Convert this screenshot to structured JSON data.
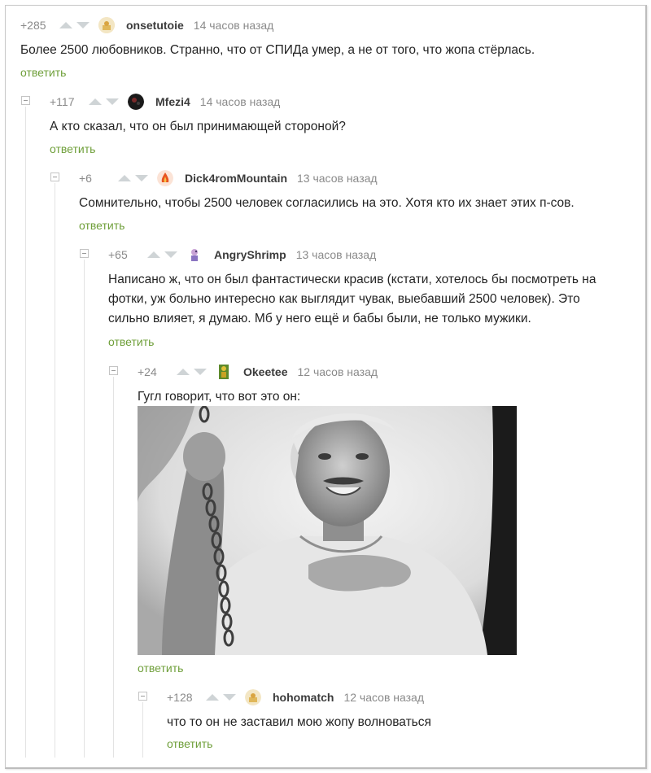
{
  "comments": [
    {
      "rating": "+285",
      "username": "onsetutoie",
      "time": "14 часов назад",
      "text": "Более 2500 любовников. Странно, что от СПИДа умер, а не от того, что жопа стёрлась.",
      "reply": "ответить"
    },
    {
      "rating": "+117",
      "username": "Mfezi4",
      "time": "14 часов назад",
      "text": "А кто сказал, что он был принимающей стороной?",
      "reply": "ответить"
    },
    {
      "rating": "+6",
      "username": "Dick4romMountain",
      "time": "13 часов назад",
      "text": "Сомнительно, чтобы 2500 человек согласились на это. Хотя кто их знает этих п-сов.",
      "reply": "ответить"
    },
    {
      "rating": "+65",
      "username": "AngryShrimp",
      "time": "13 часов назад",
      "text_lines": [
        "Написано ж, что он был фантастически красив (кстати, хотелось бы посмотреть на",
        "фотки, уж больно интересно как выглядит чувак, выебавший 2500 человек). Это",
        "сильно влияет, я думаю. Мб у него ещё и бабы были, не только мужики."
      ],
      "reply": "ответить"
    },
    {
      "rating": "+24",
      "username": "Okeetee",
      "time": "12 часов назад",
      "text": "Гугл говорит, что вот это он:",
      "reply": "ответить"
    },
    {
      "rating": "+128",
      "username": "hohomatch",
      "time": "12 часов назад",
      "text": "что то он не заставил мою жопу волноваться",
      "reply": "ответить"
    }
  ],
  "colors": {
    "reply_link": "#6f9f3a",
    "meta_gray": "#8a8a8a",
    "vote_arrow": "#cfd4d6"
  },
  "icons": {
    "upvote": "arrow-up-icon",
    "downvote": "arrow-down-icon",
    "collapse": "collapse-minus-icon"
  }
}
